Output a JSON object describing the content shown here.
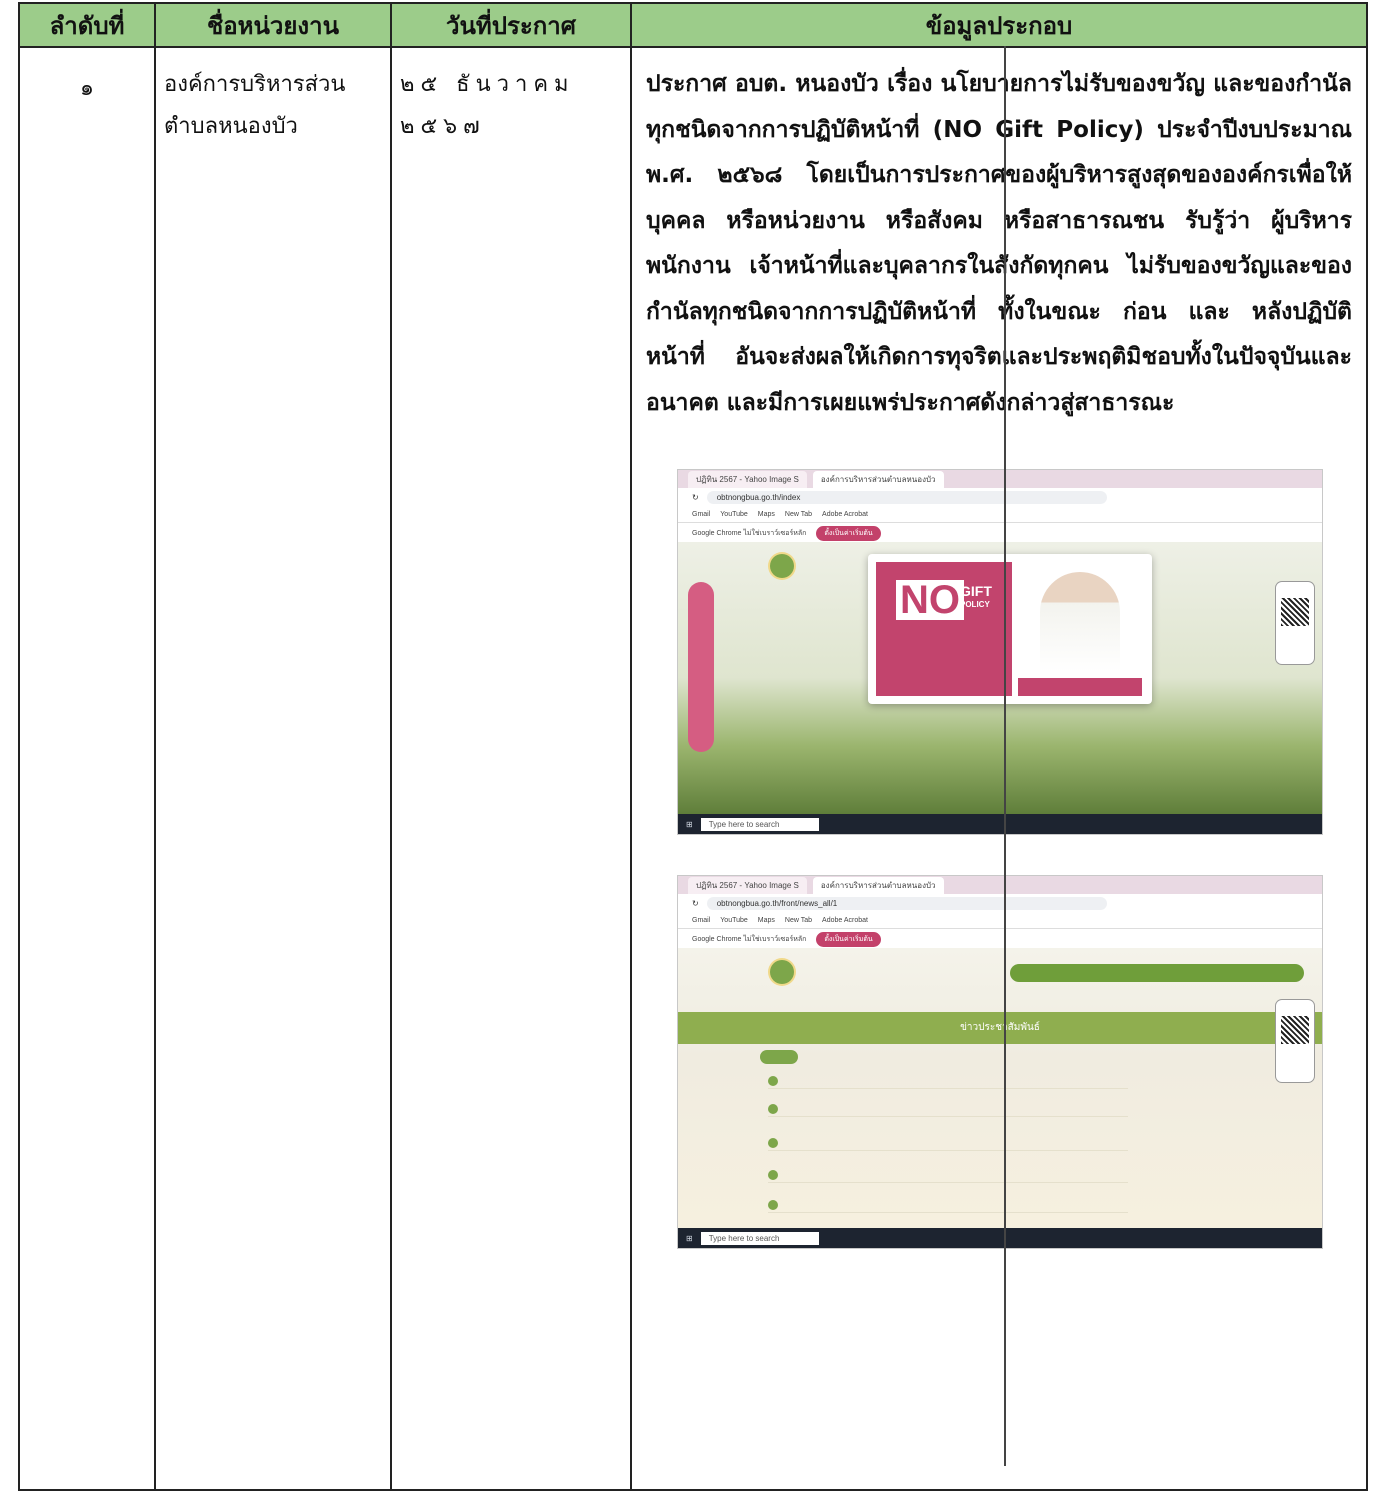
{
  "table": {
    "headers": [
      "ลำดับที่",
      "ชื่อหน่วยงาน",
      "วันที่ประกาศ",
      "ข้อมูลประกอบ"
    ],
    "row": {
      "no": "๑",
      "org_line1": "องค์การบริหารส่วน",
      "org_line2": "ตำบลหนองบัว",
      "date_line1": "๒๕ ธันวาคม",
      "date_line2": "๒๕๖๗",
      "info": "ประกาศ อบต. หนองบัว เรื่อง นโยบายการไม่รับของขวัญ และของกำนัลทุกชนิดจากการปฏิบัติหน้าที่ (NO Gift Policy) ประจำปีงบประมาณ พ.ศ. ๒๕๖๘ โดยเป็นการประกาศของผู้บริหารสูงสุดขององค์กรเพื่อให้บุคคล หรือหน่วยงาน หรือสังคม หรือสาธารณชน รับรู้ว่า ผู้บริหาร พนักงาน เจ้าหน้าที่และบุคลากรในสังกัดทุกคน ไม่รับของขวัญและของกำนัลทุกชนิดจากการปฏิบัติหน้าที่ ทั้งในขณะ ก่อน และ หลังปฏิบัติหน้าที่ อันจะส่งผลให้เกิดการทุจริตและประพฤติมิชอบทั้งในปัจจุบันและอนาคต และมีการเผยแพร่ประกาศดังกล่าวสู่สาธารณะ"
    }
  },
  "screenshot1": {
    "tab": "ปฏิทิน 2567 - Yahoo Image S",
    "tab2": "องค์การบริหารส่วนตำบลหนองบัว",
    "url": "obtnongbua.go.th/index",
    "bookmarks": [
      "Gmail",
      "YouTube",
      "Maps",
      "New Tab",
      "Adobe Acrobat"
    ],
    "notice": "Google Chrome ไม่ใช่เบราว์เซอร์หลัก",
    "notice_button": "ตั้งเป็นค่าเริ่มต้น",
    "popup_no": "NO",
    "popup_gift": "GIFT",
    "popup_policy": "POLICY",
    "taskbar_search": "Type here to search"
  },
  "screenshot2": {
    "tab": "ปฏิทิน 2567 - Yahoo Image S",
    "tab2": "องค์การบริหารส่วนตำบลหนองบัว",
    "url": "obtnongbua.go.th/front/news_all/1",
    "bookmarks": [
      "Gmail",
      "YouTube",
      "Maps",
      "New Tab",
      "Adobe Acrobat"
    ],
    "notice": "Google Chrome ไม่ใช่เบราว์เซอร์หลัก",
    "notice_button": "ตั้งเป็นค่าเริ่มต้น",
    "banner": "ข่าวประชาสัมพันธ์",
    "taskbar_search": "Type here to search"
  }
}
